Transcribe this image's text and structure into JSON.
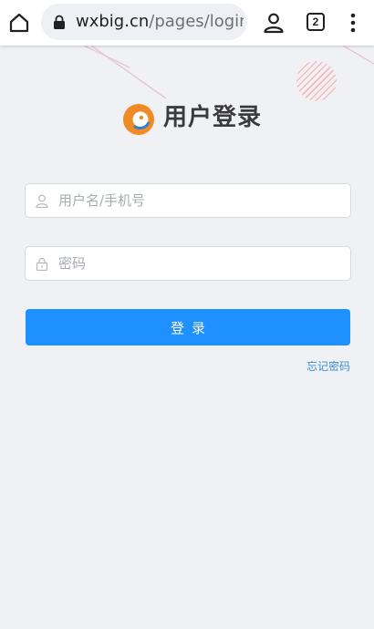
{
  "browser": {
    "url_domain": "wxbig.cn",
    "url_path": "/pages/login.l",
    "tab_count": "2"
  },
  "page": {
    "title": "用户登录",
    "username_placeholder": "用户名/手机号",
    "password_placeholder": "密码",
    "login_label": "登录",
    "forgot_label": "忘记密码"
  },
  "colors": {
    "primary": "#1e90ff",
    "link": "#3e8ed0",
    "background": "#f0f1f5"
  }
}
